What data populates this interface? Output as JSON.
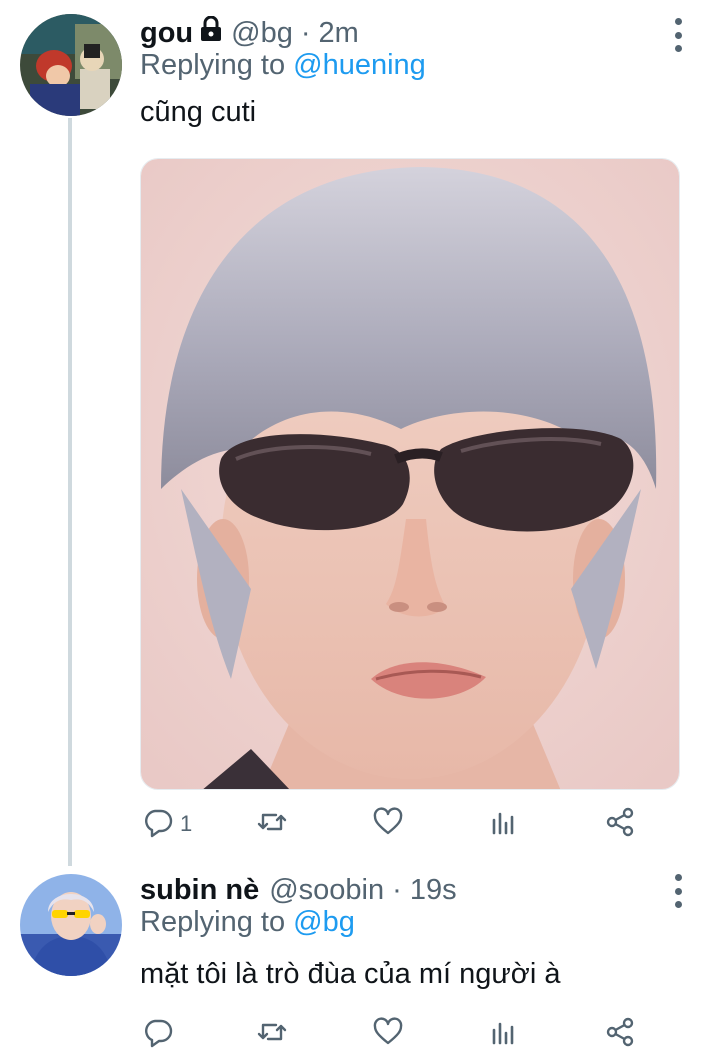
{
  "tweets": [
    {
      "name": "gou",
      "protected": true,
      "handle": "@bg",
      "separator": "·",
      "time": "2m",
      "replying_prefix": "Replying to",
      "replying_to": "@huening",
      "text": "cũng cuti",
      "has_media": true,
      "reply_count": "1"
    },
    {
      "name": "subin nè",
      "protected": false,
      "handle": "@soobin",
      "separator": "·",
      "time": "19s",
      "replying_prefix": "Replying to",
      "replying_to": "@bg",
      "text": "mặt tôi là trò đùa của mí người à",
      "has_media": false,
      "reply_count": ""
    }
  ],
  "icons": {
    "reply": "reply-icon",
    "retweet": "retweet-icon",
    "like": "heart-icon",
    "stats": "stats-icon",
    "share": "share-icon",
    "more": "more-vertical-icon",
    "lock": "lock-icon"
  },
  "colors": {
    "text": "#0f1419",
    "secondary": "#536471",
    "link": "#1d9bf0",
    "thread_line": "#cfd9de"
  }
}
